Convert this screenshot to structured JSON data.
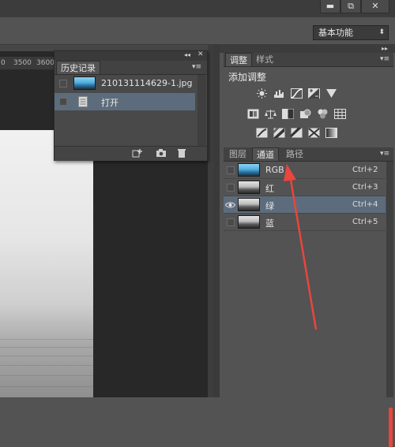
{
  "window_controls": {
    "minimize": "▬",
    "restore": "⧉",
    "close": "✕"
  },
  "options_bar": {
    "workspace_label": "基本功能",
    "workspace_caret": "⬍"
  },
  "ruler": {
    "ticks": [
      "0",
      "3500",
      "3600"
    ]
  },
  "history_panel": {
    "collapse_glyph": "◂◂",
    "close_glyph": "✕",
    "tab_label": "历史记录",
    "menu_glyph": "▾≡",
    "snapshot_label": "210131114629-1.jpg",
    "items": [
      {
        "label": "打开",
        "selected": true
      }
    ],
    "footer_icons": [
      "new-document-from-state-icon",
      "camera-icon",
      "trash-icon"
    ]
  },
  "right_panels": {
    "collapse_glyph": "▸▸",
    "adjustments": {
      "tabs": [
        "调整",
        "样式"
      ],
      "menu_glyph": "▾≡",
      "title": "添加调整",
      "row1_icons": [
        "brightness-contrast-icon",
        "levels-icon",
        "curves-icon",
        "exposure-icon",
        "vibrance-icon"
      ],
      "row2_icons": [
        "hue-saturation-icon",
        "color-balance-icon",
        "black-white-icon",
        "photo-filter-icon",
        "channel-mixer-icon",
        "color-lookup-icon"
      ],
      "row3_icons": [
        "invert-icon",
        "posterize-icon",
        "threshold-icon",
        "selective-color-icon",
        "gradient-map-icon"
      ]
    },
    "channels": {
      "tabs": [
        "图层",
        "通道",
        "路径"
      ],
      "active_tab": "通道",
      "menu_glyph": "▾≡",
      "rows": [
        {
          "name": "RGB",
          "shortcut": "Ctrl+2",
          "visible": false,
          "selected": false,
          "thumb": "color"
        },
        {
          "name": "红",
          "shortcut": "Ctrl+3",
          "visible": false,
          "selected": false,
          "thumb": "gray"
        },
        {
          "name": "绿",
          "shortcut": "Ctrl+4",
          "visible": true,
          "selected": true,
          "thumb": "gray"
        },
        {
          "name": "蓝",
          "shortcut": "Ctrl+5",
          "visible": false,
          "selected": false,
          "thumb": "gray"
        }
      ]
    }
  },
  "colors": {
    "selection": "#5d6c7c",
    "annotation_arrow": "#e8463e",
    "panel_bg": "#535353",
    "document_bg": "#282828"
  }
}
